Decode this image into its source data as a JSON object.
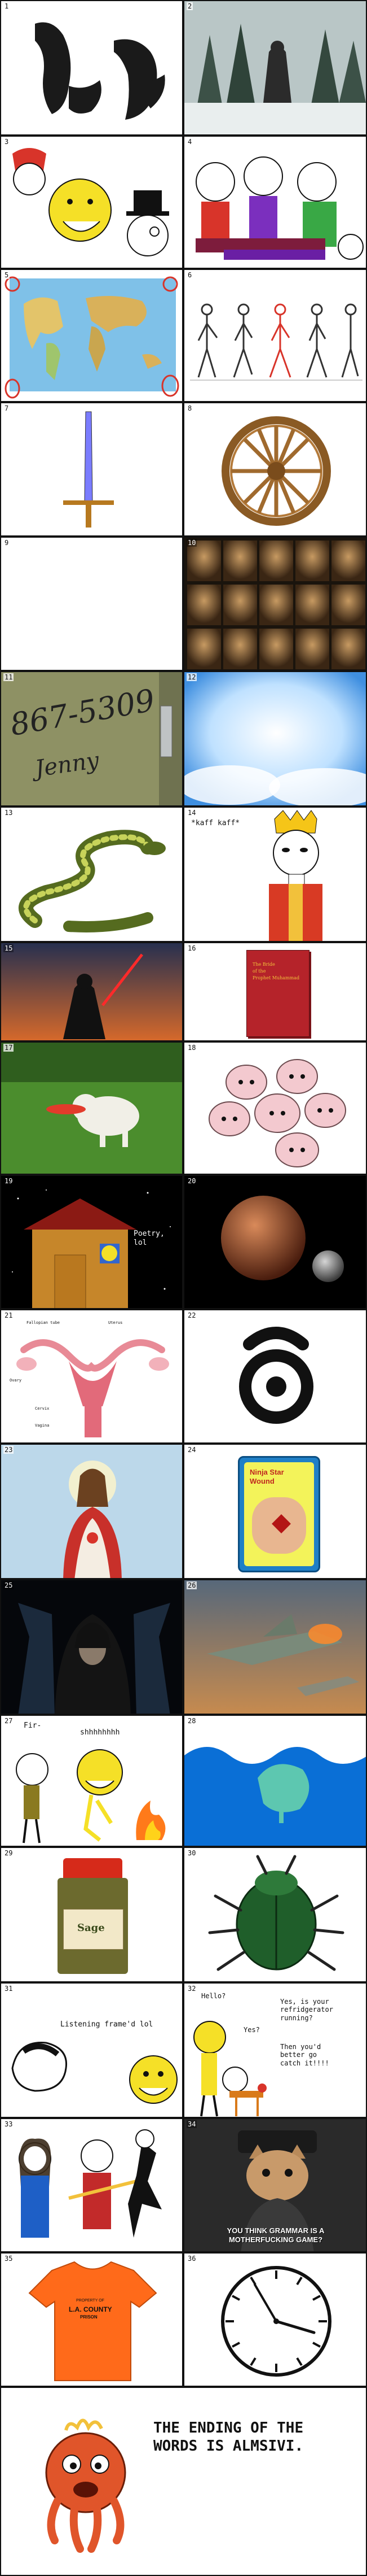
{
  "panels": [
    {
      "n": "1"
    },
    {
      "n": "2"
    },
    {
      "n": "3"
    },
    {
      "n": "4"
    },
    {
      "n": "5"
    },
    {
      "n": "6"
    },
    {
      "n": "7"
    },
    {
      "n": "8"
    },
    {
      "n": "9"
    },
    {
      "n": "10"
    },
    {
      "n": "11"
    },
    {
      "n": "12"
    },
    {
      "n": "13"
    },
    {
      "n": "14"
    },
    {
      "n": "15"
    },
    {
      "n": "16"
    },
    {
      "n": "17"
    },
    {
      "n": "18"
    },
    {
      "n": "19"
    },
    {
      "n": "20"
    },
    {
      "n": "21"
    },
    {
      "n": "22"
    },
    {
      "n": "23"
    },
    {
      "n": "24"
    },
    {
      "n": "25"
    },
    {
      "n": "26"
    },
    {
      "n": "27"
    },
    {
      "n": "28"
    },
    {
      "n": "29"
    },
    {
      "n": "30"
    },
    {
      "n": "31"
    },
    {
      "n": "32"
    },
    {
      "n": "33"
    },
    {
      "n": "34"
    },
    {
      "n": "35"
    },
    {
      "n": "36"
    }
  ],
  "p11_phone": "867-5309",
  "p11_name": "Jenny",
  "p14_text": "*kaff kaff*",
  "p16_book_lines": [
    "The Bride",
    "of the",
    "Prophet Muhammad"
  ],
  "p19_text": "Poetry,\nlol",
  "p21_labels": [
    "Fallopian tube",
    "Uterus",
    "Ovary",
    "Cervix",
    "Vagina"
  ],
  "p24_package": {
    "title": "Ninja Star",
    "subtitle": "Wound"
  },
  "p27_a": "Fir-",
  "p27_b": "shhhhhhhh",
  "p29_label": "Sage",
  "p31_text": "Listening frame'd lol",
  "p32": {
    "hello": "Hello?",
    "yes": "Yes?",
    "question": "Yes, is your\nrefridgerator\nrunning?",
    "answer": "Then you'd\nbetter go\ncatch it!!!!"
  },
  "p34_caption": "YOU THINK GRAMMAR IS A\nMOTHERFUCKING GAME?",
  "p35_shirt": {
    "small": "PROPERTY OF",
    "big": "L.A. COUNTY",
    "sub": "PRISON"
  },
  "ending_text": "THE ENDING OF THE WORDS IS ALMSIVI.",
  "colors": {
    "border": "#111111",
    "meme_yellow": "#f5e027",
    "sky": "#0a6fd6"
  }
}
